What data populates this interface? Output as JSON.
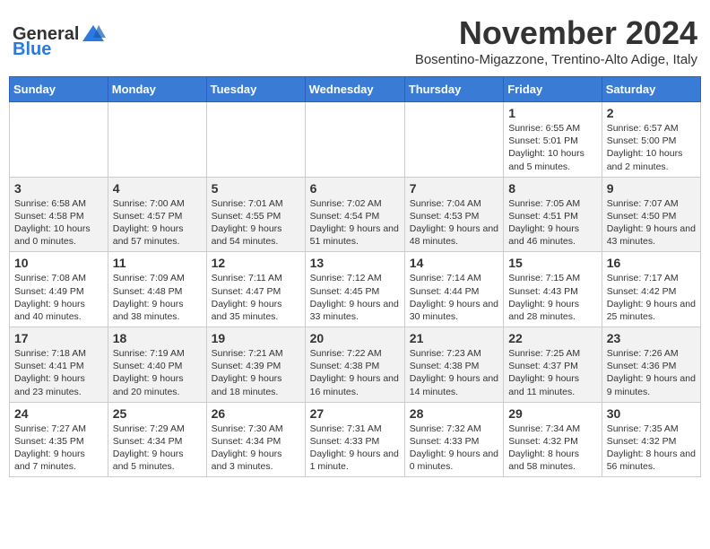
{
  "logo": {
    "text_general": "General",
    "text_blue": "Blue"
  },
  "title": "November 2024",
  "subtitle": "Bosentino-Migazzone, Trentino-Alto Adige, Italy",
  "days_of_week": [
    "Sunday",
    "Monday",
    "Tuesday",
    "Wednesday",
    "Thursday",
    "Friday",
    "Saturday"
  ],
  "weeks": [
    [
      {
        "day": "",
        "info": ""
      },
      {
        "day": "",
        "info": ""
      },
      {
        "day": "",
        "info": ""
      },
      {
        "day": "",
        "info": ""
      },
      {
        "day": "",
        "info": ""
      },
      {
        "day": "1",
        "info": "Sunrise: 6:55 AM\nSunset: 5:01 PM\nDaylight: 10 hours and 5 minutes."
      },
      {
        "day": "2",
        "info": "Sunrise: 6:57 AM\nSunset: 5:00 PM\nDaylight: 10 hours and 2 minutes."
      }
    ],
    [
      {
        "day": "3",
        "info": "Sunrise: 6:58 AM\nSunset: 4:58 PM\nDaylight: 10 hours and 0 minutes."
      },
      {
        "day": "4",
        "info": "Sunrise: 7:00 AM\nSunset: 4:57 PM\nDaylight: 9 hours and 57 minutes."
      },
      {
        "day": "5",
        "info": "Sunrise: 7:01 AM\nSunset: 4:55 PM\nDaylight: 9 hours and 54 minutes."
      },
      {
        "day": "6",
        "info": "Sunrise: 7:02 AM\nSunset: 4:54 PM\nDaylight: 9 hours and 51 minutes."
      },
      {
        "day": "7",
        "info": "Sunrise: 7:04 AM\nSunset: 4:53 PM\nDaylight: 9 hours and 48 minutes."
      },
      {
        "day": "8",
        "info": "Sunrise: 7:05 AM\nSunset: 4:51 PM\nDaylight: 9 hours and 46 minutes."
      },
      {
        "day": "9",
        "info": "Sunrise: 7:07 AM\nSunset: 4:50 PM\nDaylight: 9 hours and 43 minutes."
      }
    ],
    [
      {
        "day": "10",
        "info": "Sunrise: 7:08 AM\nSunset: 4:49 PM\nDaylight: 9 hours and 40 minutes."
      },
      {
        "day": "11",
        "info": "Sunrise: 7:09 AM\nSunset: 4:48 PM\nDaylight: 9 hours and 38 minutes."
      },
      {
        "day": "12",
        "info": "Sunrise: 7:11 AM\nSunset: 4:47 PM\nDaylight: 9 hours and 35 minutes."
      },
      {
        "day": "13",
        "info": "Sunrise: 7:12 AM\nSunset: 4:45 PM\nDaylight: 9 hours and 33 minutes."
      },
      {
        "day": "14",
        "info": "Sunrise: 7:14 AM\nSunset: 4:44 PM\nDaylight: 9 hours and 30 minutes."
      },
      {
        "day": "15",
        "info": "Sunrise: 7:15 AM\nSunset: 4:43 PM\nDaylight: 9 hours and 28 minutes."
      },
      {
        "day": "16",
        "info": "Sunrise: 7:17 AM\nSunset: 4:42 PM\nDaylight: 9 hours and 25 minutes."
      }
    ],
    [
      {
        "day": "17",
        "info": "Sunrise: 7:18 AM\nSunset: 4:41 PM\nDaylight: 9 hours and 23 minutes."
      },
      {
        "day": "18",
        "info": "Sunrise: 7:19 AM\nSunset: 4:40 PM\nDaylight: 9 hours and 20 minutes."
      },
      {
        "day": "19",
        "info": "Sunrise: 7:21 AM\nSunset: 4:39 PM\nDaylight: 9 hours and 18 minutes."
      },
      {
        "day": "20",
        "info": "Sunrise: 7:22 AM\nSunset: 4:38 PM\nDaylight: 9 hours and 16 minutes."
      },
      {
        "day": "21",
        "info": "Sunrise: 7:23 AM\nSunset: 4:38 PM\nDaylight: 9 hours and 14 minutes."
      },
      {
        "day": "22",
        "info": "Sunrise: 7:25 AM\nSunset: 4:37 PM\nDaylight: 9 hours and 11 minutes."
      },
      {
        "day": "23",
        "info": "Sunrise: 7:26 AM\nSunset: 4:36 PM\nDaylight: 9 hours and 9 minutes."
      }
    ],
    [
      {
        "day": "24",
        "info": "Sunrise: 7:27 AM\nSunset: 4:35 PM\nDaylight: 9 hours and 7 minutes."
      },
      {
        "day": "25",
        "info": "Sunrise: 7:29 AM\nSunset: 4:34 PM\nDaylight: 9 hours and 5 minutes."
      },
      {
        "day": "26",
        "info": "Sunrise: 7:30 AM\nSunset: 4:34 PM\nDaylight: 9 hours and 3 minutes."
      },
      {
        "day": "27",
        "info": "Sunrise: 7:31 AM\nSunset: 4:33 PM\nDaylight: 9 hours and 1 minute."
      },
      {
        "day": "28",
        "info": "Sunrise: 7:32 AM\nSunset: 4:33 PM\nDaylight: 9 hours and 0 minutes."
      },
      {
        "day": "29",
        "info": "Sunrise: 7:34 AM\nSunset: 4:32 PM\nDaylight: 8 hours and 58 minutes."
      },
      {
        "day": "30",
        "info": "Sunrise: 7:35 AM\nSunset: 4:32 PM\nDaylight: 8 hours and 56 minutes."
      }
    ]
  ]
}
